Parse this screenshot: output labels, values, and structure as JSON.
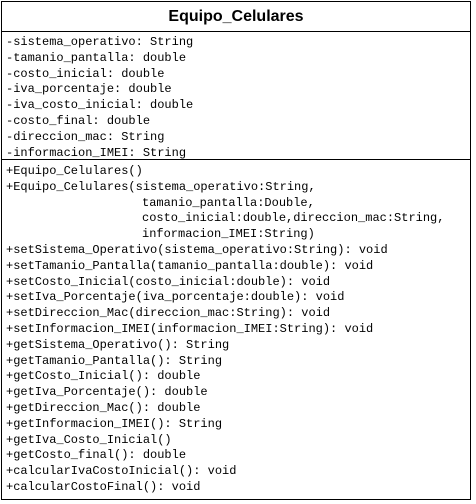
{
  "class_name": "Equipo_Celulares",
  "attributes": [
    "-sistema_operativo: String",
    "-tamanio_pantalla: double",
    "-costo_inicial: double",
    "-iva_porcentaje: double",
    "-iva_costo_inicial: double",
    "-costo_final: double",
    "-direccion_mac: String",
    "-informacion_IMEI: String"
  ],
  "constructor_default": "+Equipo_Celulares()",
  "constructor_full": [
    "+Equipo_Celulares(sistema_operativo:String,",
    "tamanio_pantalla:Double,",
    "costo_inicial:double,direccion_mac:String,",
    "informacion_IMEI:String)"
  ],
  "methods": [
    "+setSistema_Operativo(sistema_operativo:String): void",
    "+setTamanio_Pantalla(tamanio_pantalla:double): void",
    "+setCosto_Inicial(costo_inicial:double): void",
    "+setIva_Porcentaje(iva_porcentaje:double): void",
    "+setDireccion_Mac(direccion_mac:String): void",
    "+setInformacion_IMEI(informacion_IMEI:String): void",
    "+getSistema_Operativo(): String",
    "+getTamanio_Pantalla(): String",
    "+getCosto_Inicial(): double",
    "+getIva_Porcentaje(): double",
    "+getDireccion_Mac(): double",
    "+getInformacion_IMEI(): String",
    "+getIva_Costo_Inicial()",
    "+getCosto_final(): double",
    "+calcularIvaCostoInicial(): void",
    "+calcularCostoFinal(): void"
  ]
}
